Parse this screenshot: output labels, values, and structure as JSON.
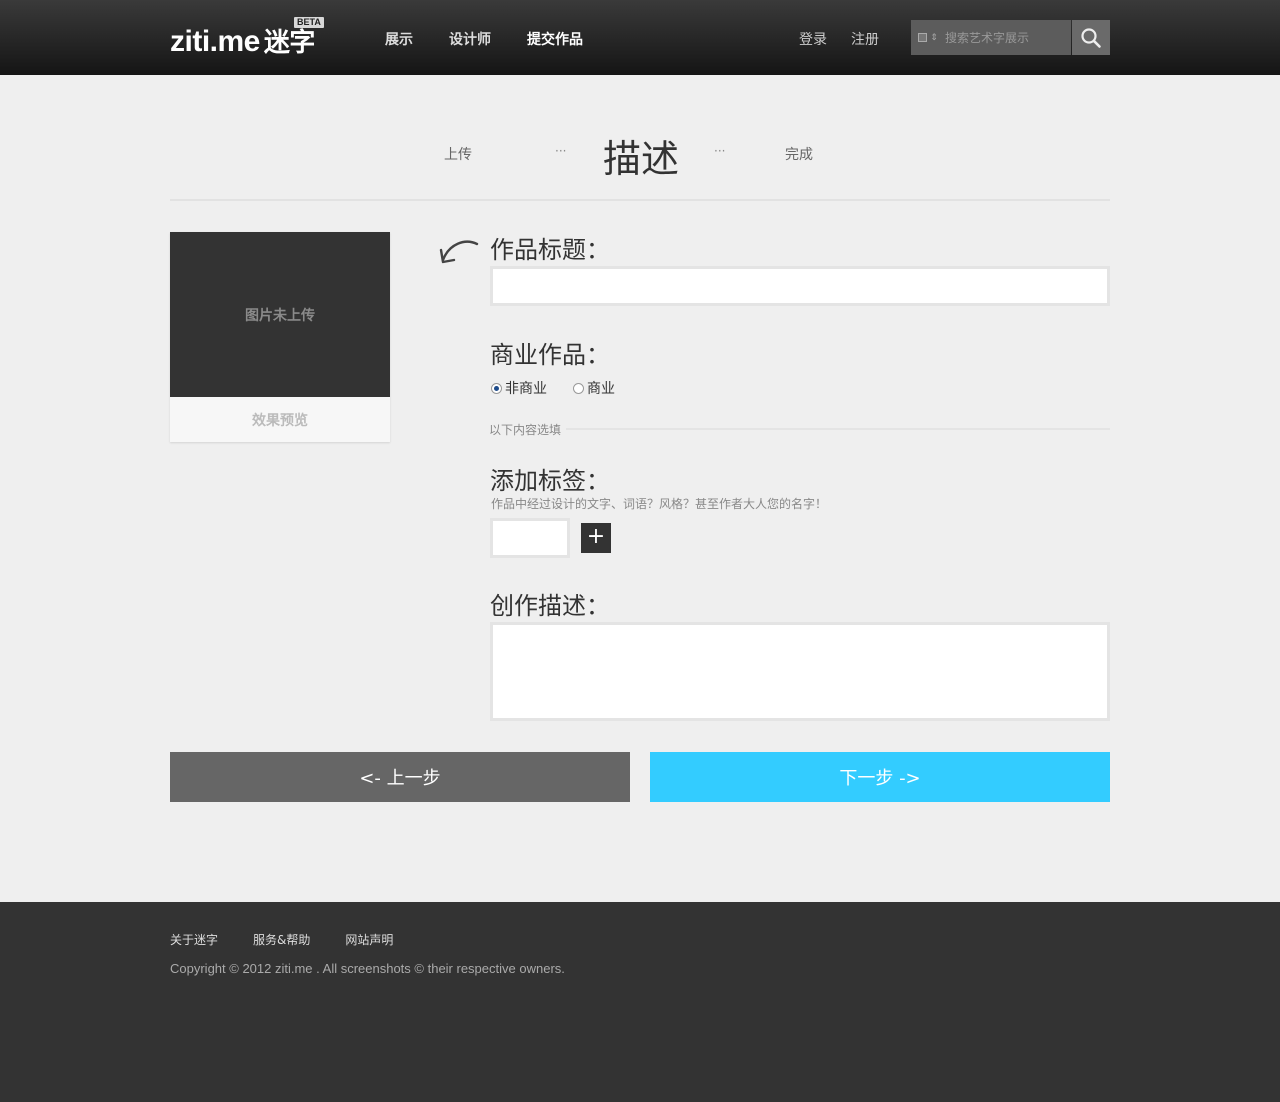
{
  "header": {
    "logo_latin": "ziti.me",
    "logo_cn": "迷字",
    "badge": "BETA",
    "nav": [
      {
        "label": "展示"
      },
      {
        "label": "设计师"
      },
      {
        "label": "提交作品"
      }
    ],
    "login": "登录",
    "register": "注册",
    "search_placeholder": "搜索艺术字展示"
  },
  "steps": {
    "step1": "上传",
    "step2": "描述",
    "step3": "完成",
    "separator": "···"
  },
  "preview": {
    "placeholder": "图片未上传",
    "caption": "效果预览"
  },
  "form": {
    "title_label": "作品标题：",
    "title_value": "",
    "commercial_label": "商业作品：",
    "radio_noncommercial": "非商业",
    "radio_commercial": "商业",
    "selected": "非商业",
    "optional_label": "以下内容选填",
    "tags_label": "添加标签：",
    "tags_hint": "作品中经过设计的文字、词语？风格？甚至作者大人您的名字！",
    "tag_add": "+",
    "description_label": "创作描述：",
    "description_value": ""
  },
  "buttons": {
    "prev": "<- 上一步",
    "next": "下一步 ->"
  },
  "footer": {
    "links": [
      {
        "label": "关于迷字"
      },
      {
        "label": "服务&帮助"
      },
      {
        "label": "网站声明"
      }
    ],
    "copyright": "Copyright © 2012 ziti.me . All screenshots © their respective owners."
  },
  "colors": {
    "accent": "#33ccff",
    "header_bg": "#1a1a1a",
    "footer_bg": "#333333",
    "page_bg": "#efefef"
  }
}
